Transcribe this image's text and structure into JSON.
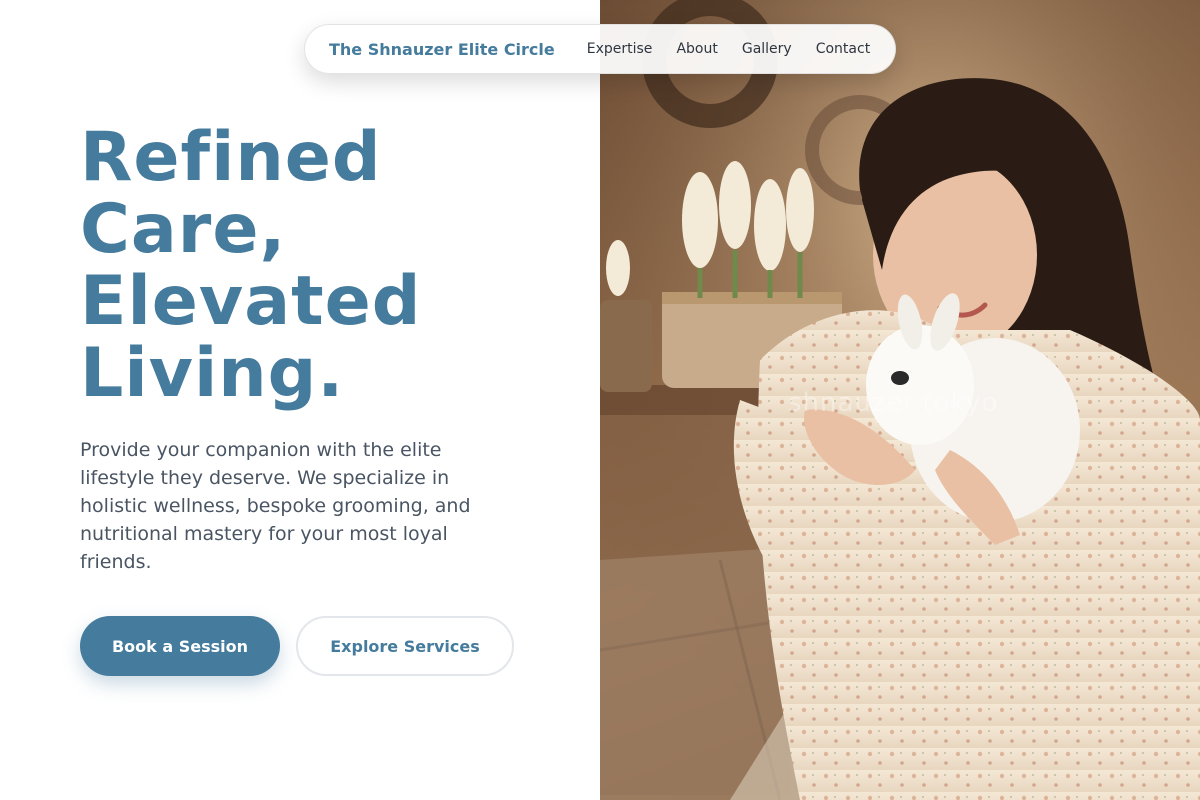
{
  "nav": {
    "brand": "The Shnauzer Elite Circle",
    "links": [
      "Expertise",
      "About",
      "Gallery",
      "Contact"
    ]
  },
  "hero": {
    "headline_lines": [
      "Refined",
      "Care,",
      "Elevated",
      "Living."
    ],
    "description": "Provide your companion with the elite lifestyle they deserve. We specialize in holistic wellness, bespoke grooming, and nutritional mastery for your most loyal friends.",
    "primary_cta": "Book a Session",
    "secondary_cta": "Explore Services"
  },
  "photo": {
    "watermark": "shnauzer.tokyo"
  },
  "colors": {
    "accent": "#457b9d",
    "body_text": "#4a5563",
    "nav_text": "#2e3640"
  }
}
